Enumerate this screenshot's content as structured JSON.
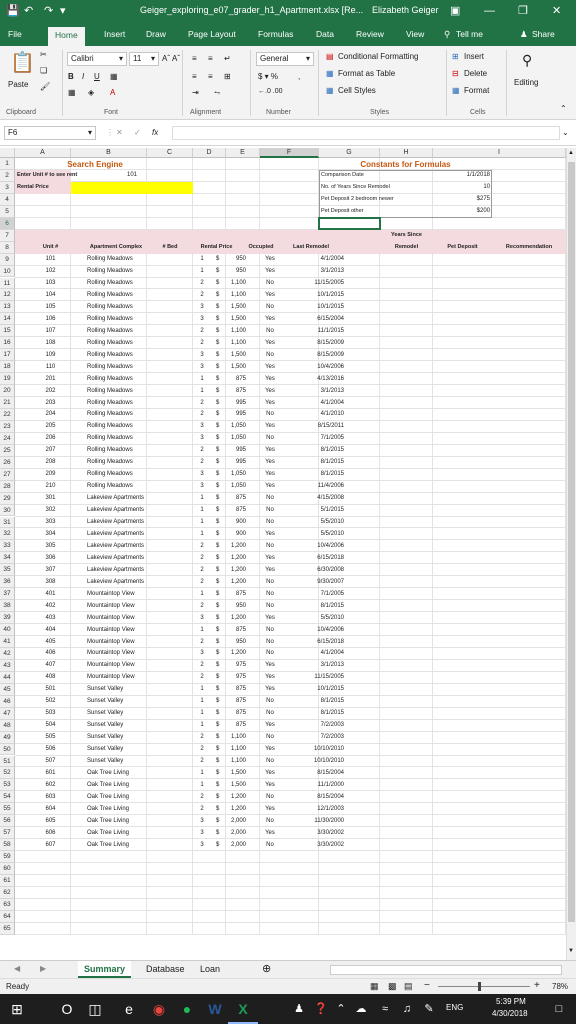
{
  "window": {
    "title": "Geiger_exploring_e07_grader_h1_Apartment.xlsx [Re...",
    "user": "Elizabeth Geiger",
    "user_initials": "EG"
  },
  "tabs": [
    "File",
    "Home",
    "Insert",
    "Draw",
    "Page Layout",
    "Formulas",
    "Data",
    "Review",
    "View"
  ],
  "tell_me": "Tell me",
  "share": "Share",
  "ribbon": {
    "paste": "Paste",
    "font_name": "Calibri",
    "font_size": "11",
    "number_format": "General",
    "conditional_formatting": "Conditional Formatting",
    "format_as_table": "Format as Table",
    "cell_styles": "Cell Styles",
    "insert": "Insert",
    "delete": "Delete",
    "format": "Format",
    "editing": "Editing",
    "groups": {
      "clipboard": "Clipboard",
      "font": "Font",
      "alignment": "Alignment",
      "number": "Number",
      "styles": "Styles",
      "cells": "Cells"
    }
  },
  "formula_bar": {
    "name_box": "F6",
    "fx": "fx",
    "formula": ""
  },
  "columns": [
    "A",
    "B",
    "C",
    "D",
    "E",
    "F",
    "G",
    "H",
    "I"
  ],
  "row_numbers": [
    "1",
    "2",
    "3",
    "4",
    "5",
    "6",
    "7",
    "8",
    "9",
    "10",
    "11",
    "12",
    "13",
    "14",
    "15",
    "16",
    "17",
    "18",
    "19",
    "20",
    "21",
    "22",
    "23",
    "24",
    "25",
    "26",
    "27",
    "28",
    "29",
    "30",
    "31",
    "32",
    "33",
    "34",
    "35",
    "36",
    "37",
    "38",
    "39",
    "40",
    "41",
    "42",
    "43",
    "44",
    "45",
    "46",
    "47",
    "48",
    "49",
    "50",
    "51",
    "52",
    "53",
    "54",
    "55",
    "56",
    "57",
    "58",
    "59",
    "60",
    "61",
    "62",
    "63",
    "64",
    "65"
  ],
  "search": {
    "title": "Search Engine",
    "enter_label": "Enter Unit # to see rent",
    "enter_value": "101",
    "rental_label": "Rental Price"
  },
  "constants": {
    "title": "Constants for Formulas",
    "rows": [
      {
        "label": "Comparison Date",
        "value": "1/1/2018"
      },
      {
        "label": "No. of Years Since Remodel",
        "value": "10"
      },
      {
        "label": "Pet Deposit 2 bedroom newer",
        "value": "$275"
      },
      {
        "label": "Pet Deposit other",
        "value": "$200"
      }
    ]
  },
  "headers": {
    "years_since_1": "Years Since",
    "unit": "Unit #",
    "complex": "Apartment Complex",
    "bed": "# Bed",
    "rent": "Rental Price",
    "occupied": "Occupied",
    "last_remodel": "Last Remodel",
    "years_since_2": "Remodel",
    "pet": "Pet Deposit",
    "rec": "Recommendation"
  },
  "currency": "$",
  "rows": [
    [
      "101",
      "Rolling Meadows",
      "1",
      "950",
      "Yes",
      "4/1/2004"
    ],
    [
      "102",
      "Rolling Meadows",
      "1",
      "950",
      "Yes",
      "3/1/2013"
    ],
    [
      "103",
      "Rolling Meadows",
      "2",
      "1,100",
      "No",
      "11/15/2005"
    ],
    [
      "104",
      "Rolling Meadows",
      "2",
      "1,100",
      "Yes",
      "10/1/2015"
    ],
    [
      "105",
      "Rolling Meadows",
      "3",
      "1,500",
      "No",
      "10/1/2015"
    ],
    [
      "106",
      "Rolling Meadows",
      "3",
      "1,500",
      "Yes",
      "6/15/2004"
    ],
    [
      "107",
      "Rolling Meadows",
      "2",
      "1,100",
      "No",
      "11/1/2015"
    ],
    [
      "108",
      "Rolling Meadows",
      "2",
      "1,100",
      "Yes",
      "8/15/2009"
    ],
    [
      "109",
      "Rolling Meadows",
      "3",
      "1,500",
      "No",
      "8/15/2009"
    ],
    [
      "110",
      "Rolling Meadows",
      "3",
      "1,500",
      "Yes",
      "10/4/2006"
    ],
    [
      "201",
      "Rolling Meadows",
      "1",
      "875",
      "Yes",
      "4/13/2016"
    ],
    [
      "202",
      "Rolling Meadows",
      "1",
      "875",
      "Yes",
      "3/1/2013"
    ],
    [
      "203",
      "Rolling Meadows",
      "2",
      "995",
      "Yes",
      "4/1/2004"
    ],
    [
      "204",
      "Rolling Meadows",
      "2",
      "995",
      "No",
      "4/1/2010"
    ],
    [
      "205",
      "Rolling Meadows",
      "3",
      "1,050",
      "Yes",
      "8/15/2011"
    ],
    [
      "206",
      "Rolling Meadows",
      "3",
      "1,050",
      "No",
      "7/1/2005"
    ],
    [
      "207",
      "Rolling Meadows",
      "2",
      "995",
      "Yes",
      "8/1/2015"
    ],
    [
      "208",
      "Rolling Meadows",
      "2",
      "995",
      "Yes",
      "8/1/2015"
    ],
    [
      "209",
      "Rolling Meadows",
      "3",
      "1,050",
      "Yes",
      "8/1/2015"
    ],
    [
      "210",
      "Rolling Meadows",
      "3",
      "1,050",
      "Yes",
      "11/4/2006"
    ],
    [
      "301",
      "Lakeview Apartments",
      "1",
      "875",
      "No",
      "4/15/2008"
    ],
    [
      "302",
      "Lakeview Apartments",
      "1",
      "875",
      "No",
      "5/1/2015"
    ],
    [
      "303",
      "Lakeview Apartments",
      "1",
      "900",
      "No",
      "5/5/2010"
    ],
    [
      "304",
      "Lakeview Apartments",
      "1",
      "900",
      "Yes",
      "5/5/2010"
    ],
    [
      "305",
      "Lakeview Apartments",
      "2",
      "1,200",
      "No",
      "10/4/2006"
    ],
    [
      "306",
      "Lakeview Apartments",
      "2",
      "1,200",
      "Yes",
      "6/15/2018"
    ],
    [
      "307",
      "Lakeview Apartments",
      "2",
      "1,200",
      "Yes",
      "6/30/2008"
    ],
    [
      "308",
      "Lakeview Apartments",
      "2",
      "1,200",
      "No",
      "9/30/2007"
    ],
    [
      "401",
      "Mountaintop View",
      "1",
      "875",
      "No",
      "7/1/2005"
    ],
    [
      "402",
      "Mountaintop View",
      "2",
      "950",
      "No",
      "8/1/2015"
    ],
    [
      "403",
      "Mountaintop View",
      "3",
      "1,200",
      "Yes",
      "5/5/2010"
    ],
    [
      "404",
      "Mountaintop View",
      "1",
      "875",
      "No",
      "10/4/2006"
    ],
    [
      "405",
      "Mountaintop View",
      "2",
      "950",
      "No",
      "6/15/2018"
    ],
    [
      "406",
      "Mountaintop View",
      "3",
      "1,200",
      "No",
      "4/1/2004"
    ],
    [
      "407",
      "Mountaintop View",
      "2",
      "975",
      "Yes",
      "3/1/2013"
    ],
    [
      "408",
      "Mountaintop View",
      "2",
      "975",
      "Yes",
      "11/15/2005"
    ],
    [
      "501",
      "Sunset Valley",
      "1",
      "875",
      "Yes",
      "10/1/2015"
    ],
    [
      "502",
      "Sunset Valley",
      "1",
      "875",
      "No",
      "8/1/2015"
    ],
    [
      "503",
      "Sunset Valley",
      "1",
      "875",
      "No",
      "8/1/2015"
    ],
    [
      "504",
      "Sunset Valley",
      "1",
      "875",
      "Yes",
      "7/2/2003"
    ],
    [
      "505",
      "Sunset Valley",
      "2",
      "1,100",
      "No",
      "7/2/2003"
    ],
    [
      "506",
      "Sunset Valley",
      "2",
      "1,100",
      "Yes",
      "10/10/2010"
    ],
    [
      "507",
      "Sunset Valley",
      "2",
      "1,100",
      "No",
      "10/10/2010"
    ],
    [
      "601",
      "Oak Tree Living",
      "1",
      "1,500",
      "Yes",
      "8/15/2004"
    ],
    [
      "602",
      "Oak Tree Living",
      "1",
      "1,500",
      "Yes",
      "11/1/2000"
    ],
    [
      "603",
      "Oak Tree Living",
      "2",
      "1,200",
      "No",
      "8/15/2004"
    ],
    [
      "604",
      "Oak Tree Living",
      "2",
      "1,200",
      "Yes",
      "12/1/2003"
    ],
    [
      "605",
      "Oak Tree Living",
      "3",
      "2,000",
      "No",
      "11/30/2000"
    ],
    [
      "606",
      "Oak Tree Living",
      "3",
      "2,000",
      "Yes",
      "3/30/2002"
    ],
    [
      "607",
      "Oak Tree Living",
      "3",
      "2,000",
      "No",
      "3/30/2002"
    ]
  ],
  "sheet_tabs": [
    "Summary",
    "Database",
    "Loan"
  ],
  "status": {
    "ready": "Ready",
    "zoom": "78%"
  },
  "taskbar": {
    "language": "ENG",
    "time": "5:39 PM",
    "date": "4/30/2018",
    "search_glyph": "O"
  },
  "colors": {
    "excel_green": "#217346",
    "header_pink": "#f4dbe0",
    "yellow": "#ffff00",
    "title_orange": "#c65911"
  }
}
